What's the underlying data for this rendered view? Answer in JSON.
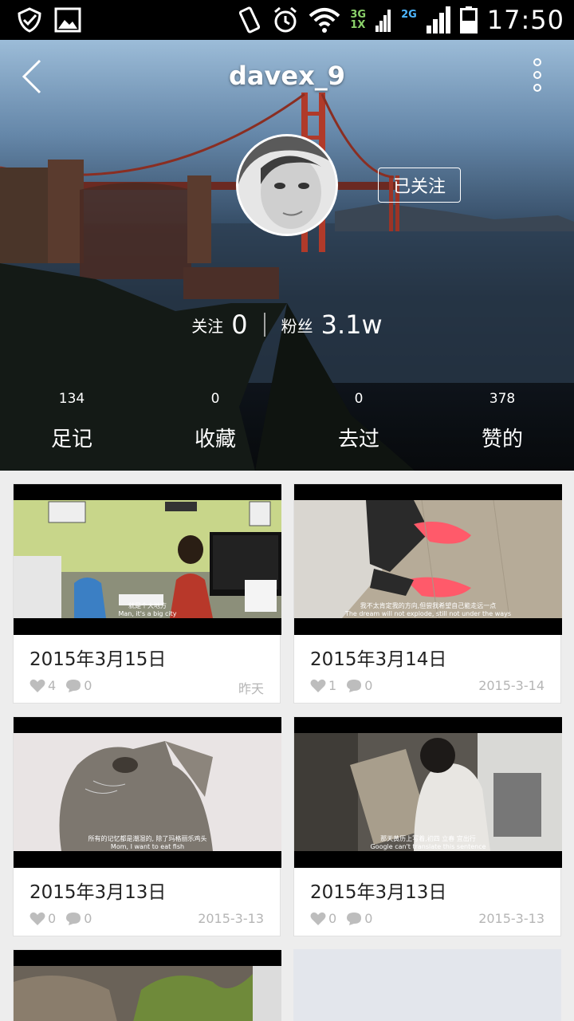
{
  "status_bar": {
    "time": "17:50",
    "net1_top": "3G",
    "net1_bottom": "1X",
    "net2_top": "2G"
  },
  "header": {
    "username": "davex_9",
    "follow_state": "已关注"
  },
  "stats": {
    "following_label": "关注",
    "following_value": "0",
    "fans_label": "粉丝",
    "fans_value": "3.1w"
  },
  "tabs": [
    {
      "count": "134",
      "label": "足记"
    },
    {
      "count": "0",
      "label": "收藏"
    },
    {
      "count": "0",
      "label": "去过"
    },
    {
      "count": "378",
      "label": "赞的"
    }
  ],
  "cards": [
    {
      "title": "2015年3月15日",
      "likes": "4",
      "comments": "0",
      "date": "昨天",
      "sub_cn": "就是个大地方",
      "sub_en": "Man, it's a big city"
    },
    {
      "title": "2015年3月14日",
      "likes": "1",
      "comments": "0",
      "date": "2015-3-14",
      "sub_cn": "我不太肯定我的方向,但尝我希望自己能走远一点",
      "sub_en": "The dream will not explode, still not under the ways"
    },
    {
      "title": "2015年3月13日",
      "likes": "0",
      "comments": "0",
      "date": "2015-3-13",
      "sub_cn": "所有的记忆都是潮湿的, 除了玛格丽乐鸡头",
      "sub_en": "Mom, I want to eat fish"
    },
    {
      "title": "2015年3月13日",
      "likes": "0",
      "comments": "0",
      "date": "2015-3-13",
      "sub_cn": "那天黄历上写着,初四 立春 宜出行",
      "sub_en": "Google can't translate this sentence"
    }
  ],
  "colors": {
    "status_bar": "#000000",
    "page_bg": "#ededed",
    "meta_gray": "#b5b5b5"
  }
}
